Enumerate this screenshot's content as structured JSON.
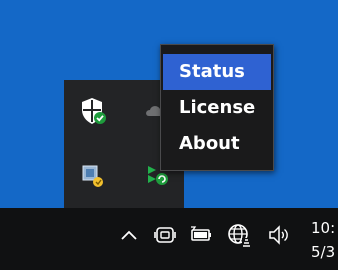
{
  "context_menu": {
    "items": [
      {
        "label": "Status",
        "highlighted": true
      },
      {
        "label": "License",
        "highlighted": false
      },
      {
        "label": "About",
        "highlighted": false
      }
    ]
  },
  "hidden_icons": [
    "windows-security-icon",
    "onedrive-icon",
    "network-app-icon",
    "sync-app-icon"
  ],
  "taskbar": {
    "icons": [
      "chevron-up-icon",
      "meet-now-icon",
      "battery-icon",
      "network-globe-icon",
      "volume-icon"
    ],
    "clock": {
      "time": "10:",
      "date": "5/3"
    }
  },
  "colors": {
    "desktop": "#1468c7",
    "menu_background": "#1a1a1b",
    "menu_highlight": "#2f62d2",
    "taskbar": "#101112",
    "flyout": "#232426"
  }
}
